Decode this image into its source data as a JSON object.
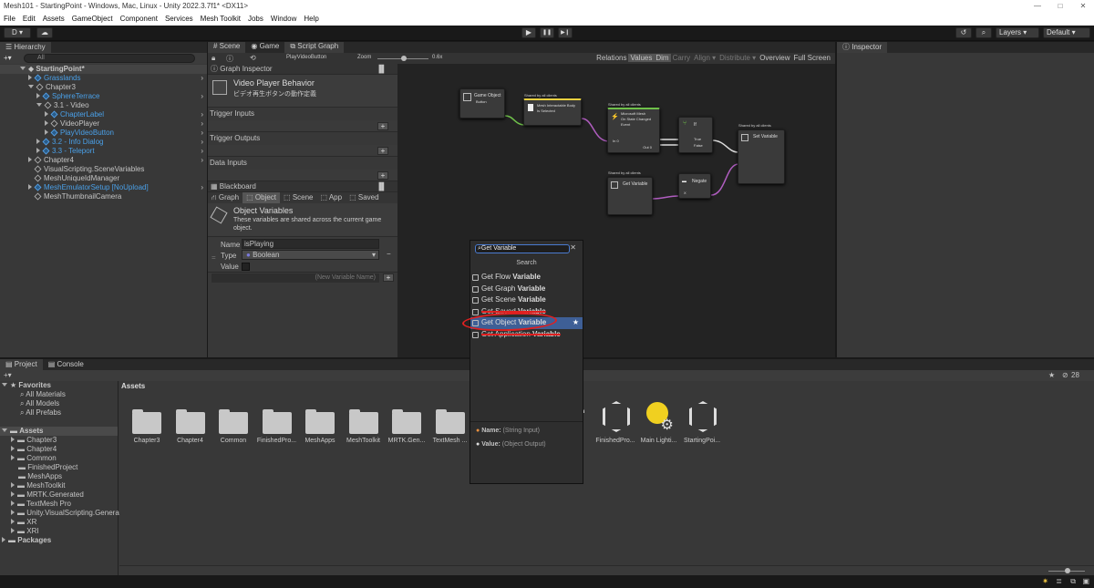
{
  "window": {
    "title": "Mesh101 - StartingPoint - Windows, Mac, Linux - Unity 2022.3.7f1* <DX11>",
    "min": "—",
    "max": "□",
    "close": "✕"
  },
  "menu": [
    "File",
    "Edit",
    "Assets",
    "GameObject",
    "Component",
    "Services",
    "Mesh Toolkit",
    "Jobs",
    "Window",
    "Help"
  ],
  "toolbar": {
    "account": "D ▾",
    "cloud": "☁",
    "play": "▶",
    "pause": "❚❚",
    "step": "▶❙",
    "history": "↺",
    "search": "⌕",
    "layers": "Layers",
    "layout": "Default"
  },
  "hierarchy": {
    "tab": "Hierarchy",
    "search_placeholder": "All",
    "scene": "StartingPoint*",
    "items": [
      {
        "label": "Grasslands",
        "indent": 1,
        "blue": true,
        "exp": "r",
        "icon": "cube-b"
      },
      {
        "label": "Chapter3",
        "indent": 1,
        "blue": false,
        "exp": "d",
        "icon": "cube"
      },
      {
        "label": "SphereTerrace",
        "indent": 2,
        "blue": true,
        "exp": "r",
        "icon": "cube-b"
      },
      {
        "label": "3.1 - Video",
        "indent": 2,
        "blue": false,
        "exp": "d",
        "icon": "cube"
      },
      {
        "label": "ChapterLabel",
        "indent": 3,
        "blue": true,
        "exp": "r",
        "icon": "cube-b"
      },
      {
        "label": "VideoPlayer",
        "indent": 3,
        "blue": false,
        "exp": "r",
        "icon": "cube"
      },
      {
        "label": "PlayVideoButton",
        "indent": 3,
        "blue": true,
        "exp": "r",
        "icon": "cube-b"
      },
      {
        "label": "3.2 - Info Dialog",
        "indent": 2,
        "blue": true,
        "exp": "r",
        "icon": "cube-b"
      },
      {
        "label": "3.3 - Teleport",
        "indent": 2,
        "blue": true,
        "exp": "r",
        "icon": "cube-b"
      },
      {
        "label": "Chapter4",
        "indent": 1,
        "blue": false,
        "exp": "r",
        "icon": "cube"
      },
      {
        "label": "VisualScripting.SceneVariables",
        "indent": 1,
        "blue": false,
        "exp": "",
        "icon": "cube"
      },
      {
        "label": "MeshUniqueIdManager",
        "indent": 1,
        "blue": false,
        "exp": "",
        "icon": "cube"
      },
      {
        "label": "MeshEmulatorSetup [NoUpload]",
        "indent": 1,
        "blue": true,
        "exp": "r",
        "icon": "cube-b"
      },
      {
        "label": "MeshThumbnailCamera",
        "indent": 1,
        "blue": false,
        "exp": "",
        "icon": "cube"
      }
    ]
  },
  "graph": {
    "tabs": [
      "Scene",
      "Game",
      "Script Graph"
    ],
    "breadcrumb": "PlayVideoButton",
    "zoom_label": "Zoom",
    "zoom_value": "0.6x",
    "actions": [
      "Relations",
      "Values",
      "Dim",
      "Carry",
      "Align ▾",
      "Distribute ▾",
      "Overview",
      "Full Screen"
    ],
    "inspector_title": "Graph Inspector",
    "behavior_title": "Video Player Behavior",
    "behavior_desc": "ビデオ再生ボタンの動作定義",
    "sections": [
      "Trigger Inputs",
      "Trigger Outputs",
      "Data Inputs"
    ],
    "blackboard": {
      "title": "Blackboard",
      "tabs": [
        "Graph",
        "Object",
        "Scene",
        "App",
        "Saved"
      ],
      "obj_title": "Object Variables",
      "obj_desc": "These variables are shared across the current game object.",
      "name_label": "Name",
      "name_value": "isPlaying",
      "type_label": "Type",
      "type_value": "Boolean",
      "value_label": "Value",
      "new_placeholder": "(New Variable Name)"
    },
    "nodes": {
      "n1": {
        "title": "Game Object",
        "sub": "Button"
      },
      "n2": {
        "cap": "Shared by all clients",
        "title": "Mesh Interactable Body",
        "sub": "Is Selected"
      },
      "n3": {
        "cap": "Shared by all clients",
        "title": "Microsoft Mesh",
        "sub": "On State Changed",
        "sub2": "Event",
        "in": "In 0",
        "out": "Out 0"
      },
      "n4": {
        "title": "If",
        "t": "True",
        "f": "False"
      },
      "n5": {
        "cap": "Shared by all clients",
        "title": "Set Variable"
      },
      "n6": {
        "cap": "Shared by all clients",
        "title": "Get Variable"
      },
      "n7": {
        "title": "Negate",
        "x": "X"
      }
    }
  },
  "inspector": {
    "tab": "Inspector"
  },
  "popup": {
    "search_value": "Get Variable",
    "heading": "Search",
    "items": [
      {
        "pre": "Get Flow ",
        "bold": "Variable",
        "sel": false,
        "strike": false
      },
      {
        "pre": "Get Graph ",
        "bold": "Variable",
        "sel": false,
        "strike": false
      },
      {
        "pre": "Get Scene ",
        "bold": "Variable",
        "sel": false,
        "strike": false
      },
      {
        "pre": "Get Saved ",
        "bold": "Variable",
        "sel": false,
        "strike": true
      },
      {
        "pre": "Get Object ",
        "bold": "Variable",
        "sel": true,
        "strike": false
      },
      {
        "pre": "Get Application ",
        "bold": "Variable",
        "sel": false,
        "strike": true
      }
    ],
    "star": "★",
    "ports": [
      {
        "name": "Name:",
        "type": "(String Input)"
      },
      {
        "name": "Value:",
        "type": "(Object Output)"
      }
    ]
  },
  "project": {
    "tabs": [
      "Project",
      "Console"
    ],
    "count": "28",
    "favorites": {
      "title": "Favorites",
      "items": [
        "All Materials",
        "All Models",
        "All Prefabs"
      ]
    },
    "assets_title": "Assets",
    "tree": [
      "Chapter3",
      "Chapter4",
      "Common",
      "FinishedProject",
      "MeshApps",
      "MeshToolkit",
      "MRTK.Generated",
      "TextMesh Pro",
      "Unity.VisualScripting.Genera",
      "XR",
      "XRI"
    ],
    "packages": "Packages",
    "grid_title": "Assets",
    "grid": [
      "Chapter3",
      "Chapter4",
      "Common",
      "FinishedPro...",
      "MeshApps",
      "MeshToolkit",
      "MRTK.Gen...",
      "TextMesh ..."
    ],
    "grid2": [
      "FinishedPro...",
      "Main Lighti...",
      "StartingPoi..."
    ]
  },
  "colors": {
    "accent": "#3e5f96",
    "blue_text": "#4aa0e8",
    "red_circle": "#e02020"
  }
}
